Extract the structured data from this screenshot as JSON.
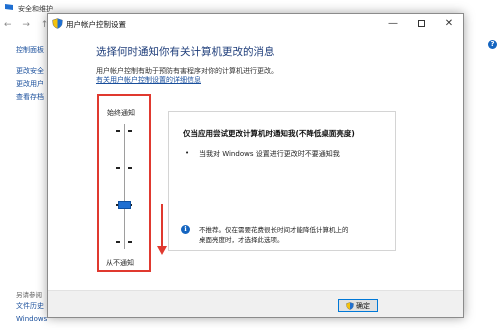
{
  "background_window": {
    "title": "安全和维护",
    "help_glyph": "?",
    "sidebar_links": [
      "控制面板",
      "更改安全",
      "更改用户",
      "查看存档"
    ],
    "footer_label": "另请参阅",
    "footer_links": [
      "文件历史",
      "Windows"
    ]
  },
  "dialog": {
    "title": "用户帐户控制设置",
    "heading": "选择何时通知你有关计算机更改的消息",
    "description": "用户帐户控制有助于预防有害程序对你的计算机进行更改。",
    "more_link": "有关用户帐户控制设置的详细信息",
    "window_controls": {
      "minimize": "—",
      "close": "✕"
    },
    "slider": {
      "top_label": "始终通知",
      "bottom_label": "从不通知",
      "level": 2,
      "levels": 4
    },
    "panel": {
      "title": "仅当应用尝试更改计算机时通知我(不降低桌面亮度)",
      "bullet": "当我对 Windows 设置进行更改时不要通知我",
      "note_line1": "不推荐。仅在需要花费很长时间才能降低计算机上的",
      "note_line2": "桌面亮度时，才选择此选项。",
      "info_glyph": "i"
    },
    "ok_label": "确定"
  },
  "colors": {
    "accent": "#1f6fd1",
    "heading": "#1e3d7a",
    "highlight": "#e0392f",
    "link": "#1a4f9c"
  },
  "icons": [
    "uac-shield-icon",
    "minimize-icon",
    "maximize-icon",
    "close-icon",
    "info-icon",
    "down-arrow-icon"
  ]
}
